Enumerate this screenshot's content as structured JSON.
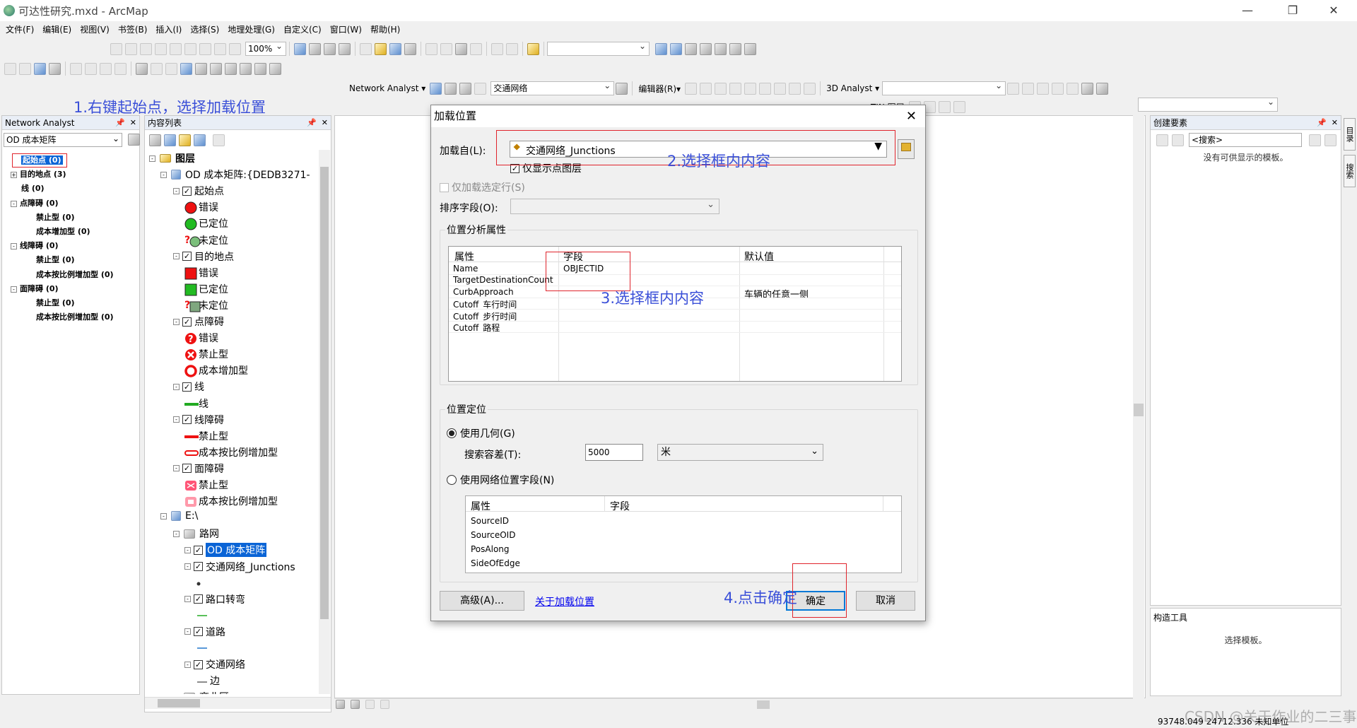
{
  "window": {
    "title": "可达性研究.mxd - ArcMap"
  },
  "menu": [
    "文件(F)",
    "编辑(E)",
    "视图(V)",
    "书签(B)",
    "插入(I)",
    "选择(S)",
    "地理处理(G)",
    "自定义(C)",
    "窗口(W)",
    "帮助(H)"
  ],
  "toolbar": {
    "zoom": "100%",
    "network_analyst": "Network Analyst ▾",
    "network_dataset": "交通网络",
    "editor": "编辑器(R)▾",
    "analyst3d": "3D Analyst ▾",
    "tin": "TIN 图层"
  },
  "na_window": {
    "title": "Network Analyst",
    "layer": "OD 成本矩阵",
    "items": [
      {
        "label": "起始点 (0)",
        "level": 0,
        "expander": ""
      },
      {
        "label": "目的地点 (3)",
        "level": 0,
        "expander": "+"
      },
      {
        "label": "线 (0)",
        "level": 0,
        "expander": ""
      },
      {
        "label": "点障碍 (0)",
        "level": 0,
        "expander": "-"
      },
      {
        "label": "禁止型 (0)",
        "level": 1,
        "expander": ""
      },
      {
        "label": "成本增加型 (0)",
        "level": 1,
        "expander": ""
      },
      {
        "label": "线障碍 (0)",
        "level": 0,
        "expander": "-"
      },
      {
        "label": "禁止型 (0)",
        "level": 1,
        "expander": ""
      },
      {
        "label": "成本按比例增加型 (0)",
        "level": 1,
        "expander": ""
      },
      {
        "label": "面障碍 (0)",
        "level": 0,
        "expander": "-"
      },
      {
        "label": "禁止型 (0)",
        "level": 1,
        "expander": ""
      },
      {
        "label": "成本按比例增加型 (0)",
        "level": 1,
        "expander": ""
      }
    ]
  },
  "toc": {
    "title": "内容列表",
    "items": [
      {
        "label": "图层",
        "level": 0,
        "kind": "layers"
      },
      {
        "label": "OD 成本矩阵:{DEDB3271-",
        "level": 1,
        "kind": "group"
      },
      {
        "label": "起始点",
        "level": 2,
        "kind": "chk"
      },
      {
        "label": "错误",
        "level": 3,
        "kind": "sym",
        "sym": "red-circle"
      },
      {
        "label": "已定位",
        "level": 3,
        "kind": "sym",
        "sym": "green-circle"
      },
      {
        "label": "未定位",
        "level": 3,
        "kind": "sym",
        "sym": "q-circle"
      },
      {
        "label": "目的地点",
        "level": 2,
        "kind": "chk"
      },
      {
        "label": "错误",
        "level": 3,
        "kind": "sym",
        "sym": "red-square"
      },
      {
        "label": "已定位",
        "level": 3,
        "kind": "sym",
        "sym": "green-square"
      },
      {
        "label": "未定位",
        "level": 3,
        "kind": "sym",
        "sym": "q-square"
      },
      {
        "label": "点障碍",
        "level": 2,
        "kind": "chk"
      },
      {
        "label": "错误",
        "level": 3,
        "kind": "sym",
        "sym": "q-red"
      },
      {
        "label": "禁止型",
        "level": 3,
        "kind": "sym",
        "sym": "x-red"
      },
      {
        "label": "成本增加型",
        "level": 3,
        "kind": "sym",
        "sym": "ring-red"
      },
      {
        "label": "线",
        "level": 2,
        "kind": "chk"
      },
      {
        "label": "线",
        "level": 3,
        "kind": "sym",
        "sym": "green-line"
      },
      {
        "label": "线障碍",
        "level": 2,
        "kind": "chk"
      },
      {
        "label": "禁止型",
        "level": 3,
        "kind": "sym",
        "sym": "red-line"
      },
      {
        "label": "成本按比例增加型",
        "level": 3,
        "kind": "sym",
        "sym": "red-line2"
      },
      {
        "label": "面障碍",
        "level": 2,
        "kind": "chk"
      },
      {
        "label": "禁止型",
        "level": 3,
        "kind": "sym",
        "sym": "red-poly"
      },
      {
        "label": "成本按比例增加型",
        "level": 3,
        "kind": "sym",
        "sym": "red-poly2"
      },
      {
        "label": "E:\\",
        "level": 1,
        "kind": "folder"
      },
      {
        "label": "路网",
        "level": 2,
        "kind": "dataset"
      },
      {
        "label": "OD 成本矩阵",
        "level": 3,
        "kind": "chk-sel"
      },
      {
        "label": "交通网络_Junctions",
        "level": 3,
        "kind": "chk"
      },
      {
        "label": "",
        "level": 4,
        "kind": "sym",
        "sym": "dot"
      },
      {
        "label": "路口转弯",
        "level": 3,
        "kind": "chk"
      },
      {
        "label": "",
        "level": 4,
        "kind": "sym",
        "sym": "green-dash"
      },
      {
        "label": "道路",
        "level": 3,
        "kind": "chk"
      },
      {
        "label": "",
        "level": 4,
        "kind": "sym",
        "sym": "blue-dash"
      },
      {
        "label": "交通网络",
        "level": 3,
        "kind": "chk"
      },
      {
        "label": "边",
        "level": 4,
        "kind": "sym",
        "sym": "gray-dash"
      },
      {
        "label": "商业区",
        "level": 2,
        "kind": "dataset"
      }
    ]
  },
  "dialog": {
    "title": "加载位置",
    "load_from_label": "加载自(L):",
    "load_from_value": "交通网络_Junctions",
    "only_points_label": "仅显示点图层",
    "only_selected_label": "仅加载选定行(S)",
    "sort_label": "排序字段(O):",
    "props_group": "位置分析属性",
    "props_headers": [
      "属性",
      "字段",
      "默认值"
    ],
    "props_rows": [
      {
        "prop": "Name",
        "field": "OBJECTID",
        "default": ""
      },
      {
        "prop": "TargetDestinationCount",
        "field": "",
        "default": ""
      },
      {
        "prop": "CurbApproach",
        "field": "",
        "default": "车辆的任意一侧"
      },
      {
        "prop": "Cutoff_车行时间",
        "field": "",
        "default": ""
      },
      {
        "prop": "Cutoff_步行时间",
        "field": "",
        "default": ""
      },
      {
        "prop": "Cutoff_路程",
        "field": "",
        "default": ""
      }
    ],
    "locate_group": "位置定位",
    "use_geometry": "使用几何(G)",
    "tolerance_label": "搜索容差(T):",
    "tolerance_value": "5000",
    "unit": "米",
    "use_network_fields": "使用网络位置字段(N)",
    "net_headers": [
      "属性",
      "字段"
    ],
    "net_rows": [
      "SourceID",
      "SourceOID",
      "PosAlong",
      "SideOfEdge"
    ],
    "advanced_btn": "高级(A)...",
    "about_link": "关于加载位置",
    "ok_btn": "确定",
    "cancel_btn": "取消"
  },
  "create_features": {
    "title": "创建要素",
    "search_placeholder": "<搜索>",
    "no_templates": "没有可供显示的模板。",
    "tools_title": "构造工具",
    "select_template": "选择模板。"
  },
  "side_tabs": [
    "目录",
    "搜索"
  ],
  "status": {
    "coords": "93748.049  24712.336 未知单位"
  },
  "annotations": {
    "a1": "1.右键起始点，选择加载位置",
    "a2": "2.选择框内内容",
    "a3": "3.选择框内内容",
    "a4": "4.点击确定"
  },
  "watermark": "CSDN @关于作业的二三事"
}
